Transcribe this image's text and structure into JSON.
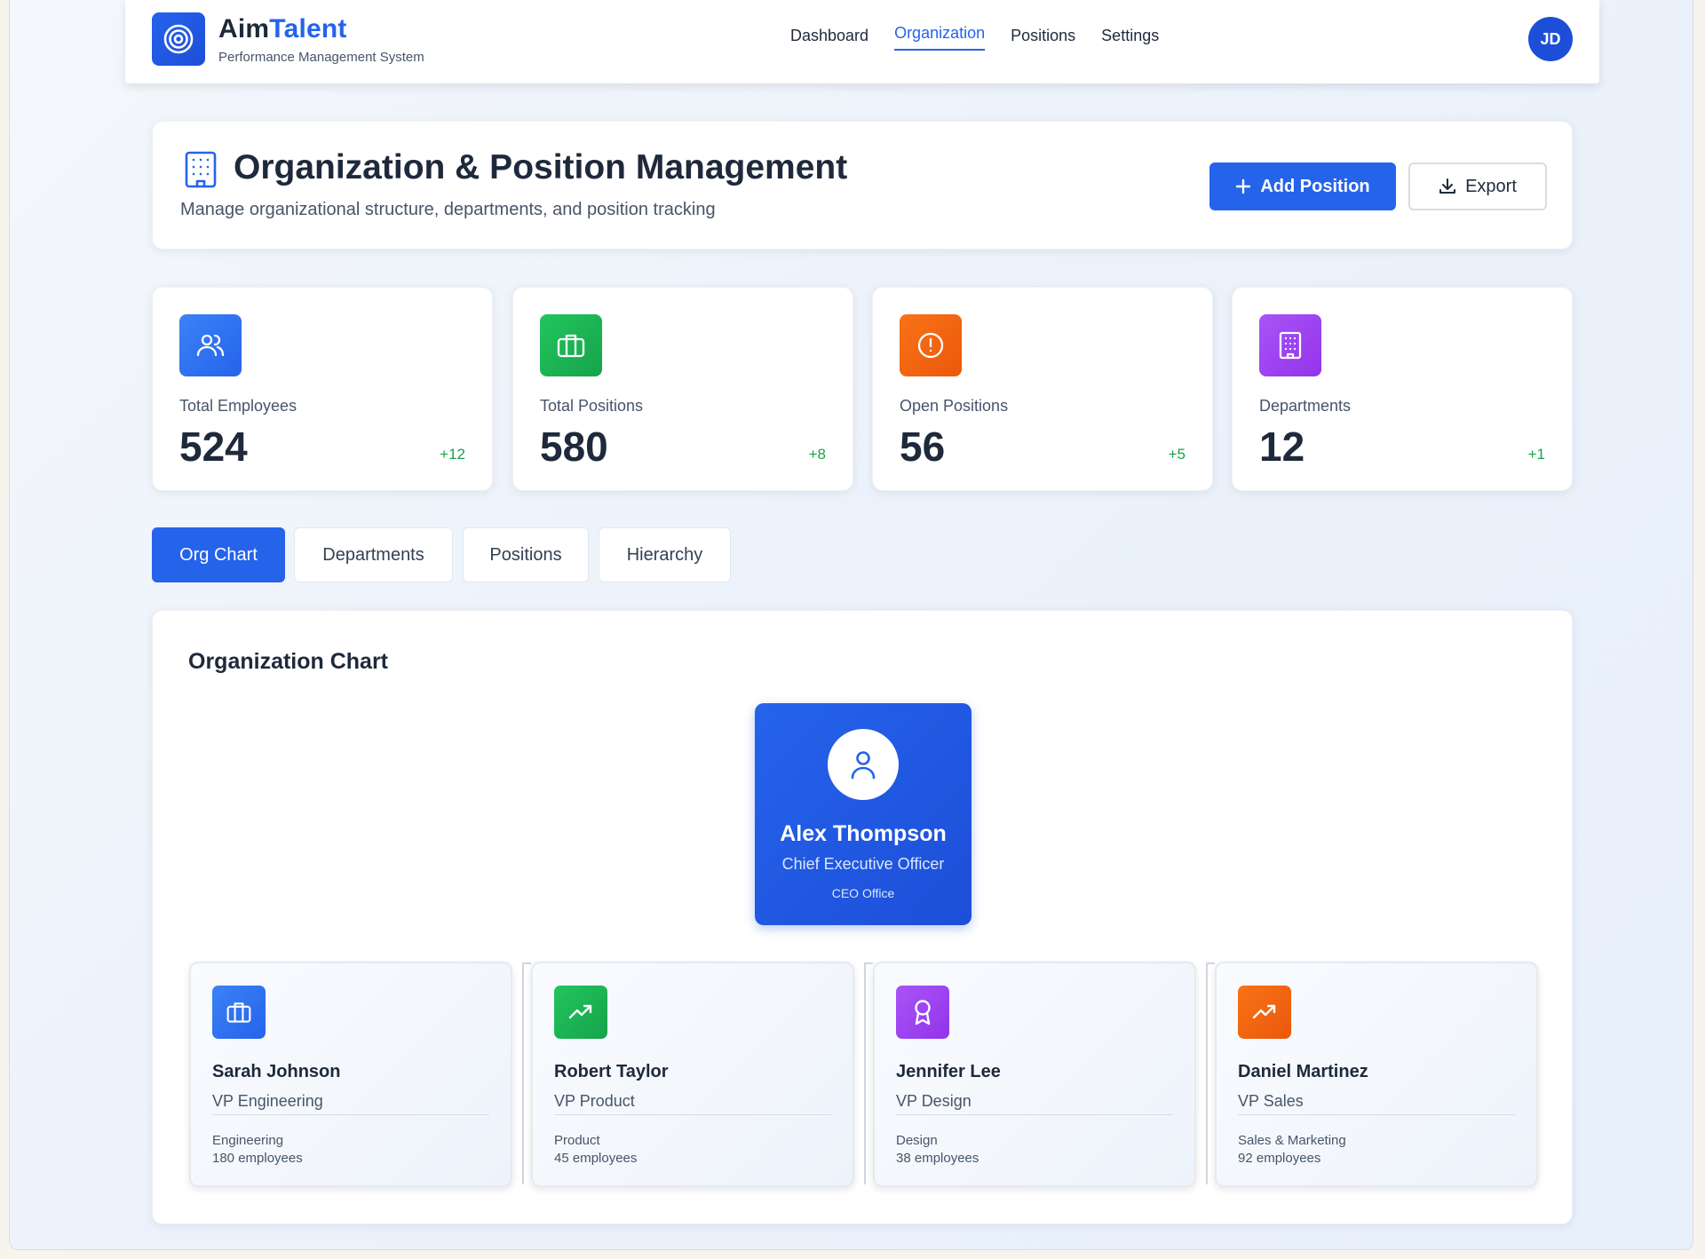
{
  "brand": {
    "name_part1": "Aim",
    "name_part2": "Talent",
    "subtitle": "Performance Management System"
  },
  "nav": {
    "items": [
      {
        "label": "Dashboard",
        "active": false
      },
      {
        "label": "Organization",
        "active": true
      },
      {
        "label": "Positions",
        "active": false
      },
      {
        "label": "Settings",
        "active": false
      }
    ],
    "avatar_initials": "JD"
  },
  "header": {
    "title": "Organization & Position Management",
    "subtitle": "Manage organizational structure, departments, and position tracking",
    "add_button": "Add Position",
    "export_button": "Export"
  },
  "stats": [
    {
      "label": "Total Employees",
      "value": "524",
      "delta": "+12",
      "icon": "users-icon",
      "color": "#2563eb"
    },
    {
      "label": "Total Positions",
      "value": "580",
      "delta": "+8",
      "icon": "briefcase-icon",
      "color": "#16a34a"
    },
    {
      "label": "Open Positions",
      "value": "56",
      "delta": "+5",
      "icon": "alert-circle-icon",
      "color": "#ea580c"
    },
    {
      "label": "Departments",
      "value": "12",
      "delta": "+1",
      "icon": "building-icon",
      "color": "#9333ea"
    }
  ],
  "tabs": [
    {
      "label": "Org Chart",
      "active": true
    },
    {
      "label": "Departments",
      "active": false
    },
    {
      "label": "Positions",
      "active": false
    },
    {
      "label": "Hierarchy",
      "active": false
    }
  ],
  "org_chart": {
    "title": "Organization Chart",
    "ceo": {
      "name": "Alex Thompson",
      "role": "Chief Executive Officer",
      "department": "CEO Office"
    },
    "vps": [
      {
        "name": "Sarah Johnson",
        "role": "VP Engineering",
        "department": "Engineering",
        "employees": "180 employees",
        "icon": "briefcase-icon",
        "color": "#2563eb"
      },
      {
        "name": "Robert Taylor",
        "role": "VP Product",
        "department": "Product",
        "employees": "45 employees",
        "icon": "trending-up-icon",
        "color": "#16a34a"
      },
      {
        "name": "Jennifer Lee",
        "role": "VP Design",
        "department": "Design",
        "employees": "38 employees",
        "icon": "award-icon",
        "color": "#9333ea"
      },
      {
        "name": "Daniel Martinez",
        "role": "VP Sales",
        "department": "Sales & Marketing",
        "employees": "92 employees",
        "icon": "trending-up-icon",
        "color": "#ea580c"
      }
    ]
  }
}
